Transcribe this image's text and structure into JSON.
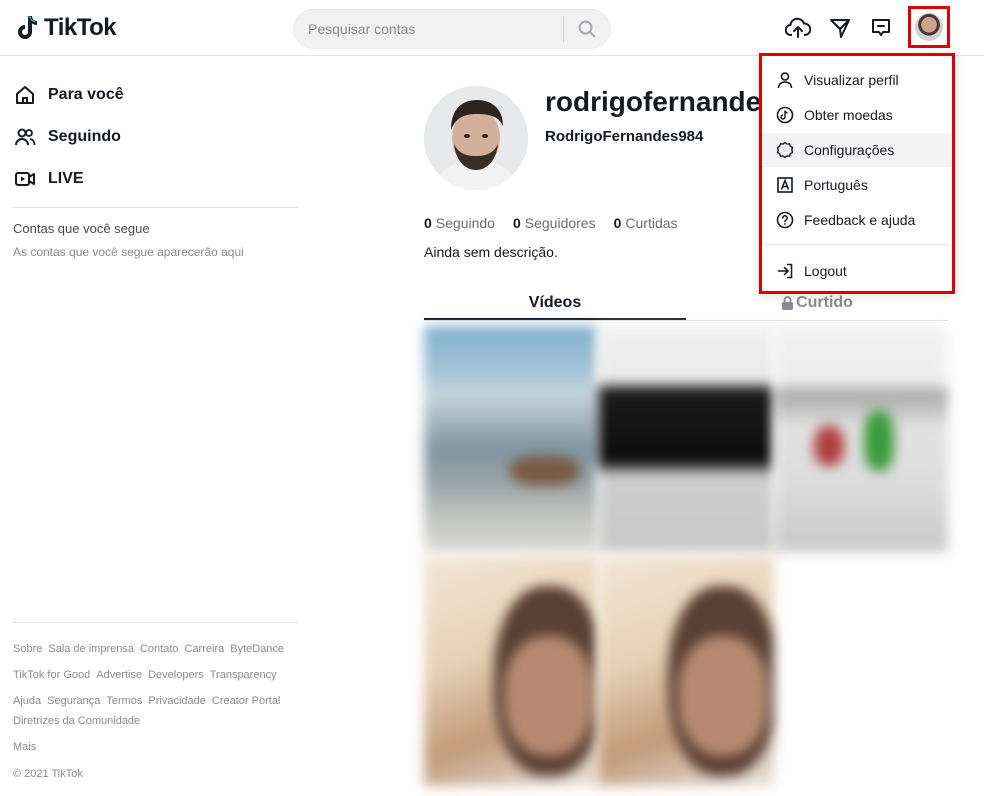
{
  "header": {
    "logo_text": "TikTok",
    "search_placeholder": "Pesquisar contas",
    "icons": [
      "upload-cloud-icon",
      "inbox-send-icon",
      "messages-icon",
      "avatar"
    ]
  },
  "sidebar": {
    "nav": [
      {
        "label": "Para você",
        "icon": "home-icon"
      },
      {
        "label": "Seguindo",
        "icon": "users-icon"
      },
      {
        "label": "LIVE",
        "icon": "live-camera-icon"
      }
    ],
    "following_title": "Contas que você segue",
    "following_empty": "As contas que você segue aparecerão aqui",
    "footer": {
      "row1": [
        "Sobre",
        "Sala de imprensa",
        "Contato",
        "Carreira",
        "ByteDance"
      ],
      "row2": [
        "TikTok for Good",
        "Advertise",
        "Developers",
        "Transparency"
      ],
      "row3": [
        "Ajuda",
        "Segurança",
        "Termos",
        "Privacidade",
        "Creator Portal"
      ],
      "row4": [
        "Diretrizes da Comunidade"
      ],
      "more": "Mais",
      "copyright": "© 2021 TikTok"
    }
  },
  "profile": {
    "username": "rodrigofernandes",
    "display_name": "RodrigoFernandes984",
    "stats": {
      "following_count": "0",
      "following_label": "Seguindo",
      "followers_count": "0",
      "followers_label": "Seguidores",
      "likes_count": "0",
      "likes_label": "Curtidas"
    },
    "bio": "Ainda sem descrição.",
    "tabs": {
      "videos": "Vídeos",
      "liked": "Curtido"
    }
  },
  "dropdown": {
    "items": [
      {
        "label": "Visualizar perfil",
        "icon": "user-icon"
      },
      {
        "label": "Obter moedas",
        "icon": "tiktok-coin-icon"
      },
      {
        "label": "Configurações",
        "icon": "settings-gear-icon"
      },
      {
        "label": "Português",
        "icon": "language-icon"
      },
      {
        "label": "Feedback e ajuda",
        "icon": "help-circle-icon"
      },
      {
        "label": "Logout",
        "icon": "logout-icon"
      }
    ]
  },
  "colors": {
    "highlight": "#e30000",
    "text": "#161823",
    "muted": "#8a8b91"
  }
}
